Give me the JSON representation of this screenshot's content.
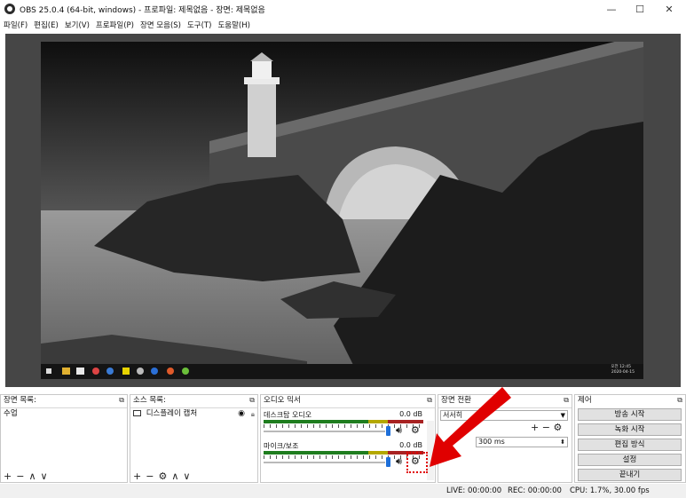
{
  "window": {
    "title": "OBS 25.0.4 (64-bit, windows) - 프로파일: 제목없음 - 장면: 제목없음",
    "controls": {
      "minimize": "—",
      "maximize": "☐",
      "close": "✕"
    }
  },
  "menu": [
    "파일(F)",
    "편집(E)",
    "보기(V)",
    "프로파일(P)",
    "장면 모음(S)",
    "도구(T)",
    "도움말(H)"
  ],
  "preview": {
    "screen_clock": "오전 12:45",
    "screen_date": "2020-04-15"
  },
  "scenes": {
    "title": "장면 목록:",
    "items": [
      "수업"
    ],
    "footer": [
      "+",
      "−",
      "∧",
      "∨"
    ]
  },
  "sources": {
    "title": "소스 목록:",
    "items": [
      {
        "label": "디스플레이 캡처",
        "visible_icon": "eye-icon",
        "lock_icon": "lock-icon"
      }
    ],
    "footer": [
      "+",
      "−",
      "⚙",
      "∧",
      "∨"
    ]
  },
  "mixer": {
    "title": "오디오 믹서",
    "channels": [
      {
        "label": "데스크탑 오디오",
        "db": "0.0 dB"
      },
      {
        "label": "마이크/보조",
        "db": "0.0 dB"
      }
    ]
  },
  "transitions": {
    "title": "장면 전환",
    "selected": "서서히",
    "duration": "300 ms",
    "footer": [
      "+",
      "−",
      "⚙"
    ]
  },
  "controls": {
    "title": "제어",
    "buttons": [
      "방송 시작",
      "녹화 시작",
      "편집 방식",
      "설정",
      "끝내기"
    ]
  },
  "status": {
    "live": "LIVE: 00:00:00",
    "rec": "REC: 00:00:00",
    "cpu": "CPU: 1.7%, 30.00 fps"
  },
  "colors": {
    "preview_bg": "#464646",
    "meter_green": "#1f7d1f",
    "meter_yellow": "#b4a800",
    "meter_red": "#a82222",
    "annotation_red": "#e00000",
    "slider_blue": "#1e6fd9"
  }
}
